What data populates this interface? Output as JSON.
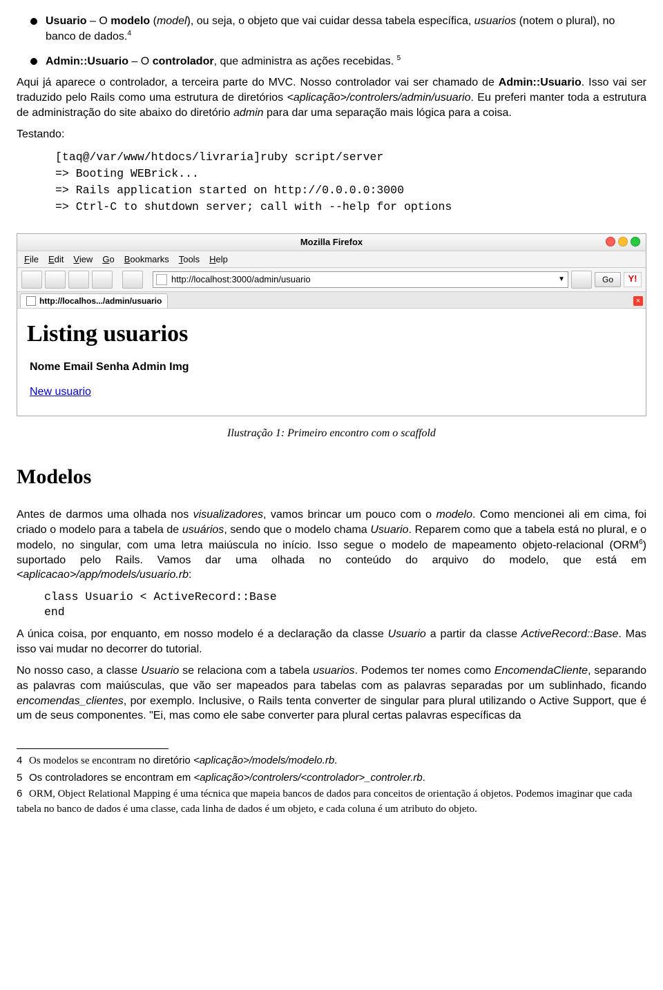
{
  "bullets": {
    "usuario": {
      "label_bold": "Usuario",
      "dash": " – O ",
      "modelo_bold": "modelo",
      "open": " (",
      "model_it": "model",
      "rest1": "), ou seja, o objeto que vai cuidar dessa tabela específica, ",
      "rest2": "usuarios",
      "rest3": " (notem o plural), no banco de dados.",
      "fn": "4"
    },
    "admin": {
      "label_bold": "Admin::Usuario",
      "dash": " – O ",
      "ctrl_bold": "controlador",
      "rest": ", que administra as ações recebidas. ",
      "fn": "5"
    }
  },
  "intro": {
    "l1a": "Aqui já aparece o controlador, a terceira parte do MVC.  Nosso controlador vai ser chamado de ",
    "l1b": "Admin::Usuario",
    "l2a": ".  Isso  vai  ser  traduzido  pelo  Rails  como  uma  estrutura  de  diretórios ",
    "path": "<aplicação>/controlers/admin/usuario",
    "l3": ". Eu preferi manter toda a estrutura de administração do site abaixo do diretório ",
    "admin_it": "admin",
    "l4": " para dar uma separação mais lógica para a coisa."
  },
  "testing_label": "Testando:",
  "terminal": "[taq@/var/www/htdocs/livraria]ruby script/server\n=> Booting WEBrick...\n=> Rails application started on http://0.0.0.0:3000\n=> Ctrl-C to shutdown server; call with --help for options",
  "browser": {
    "title": "Mozilla Firefox",
    "menus": {
      "file": "File",
      "edit": "Edit",
      "view": "View",
      "go": "Go",
      "bookmarks": "Bookmarks",
      "tools": "Tools",
      "help": "Help"
    },
    "url": "http://localhost:3000/admin/usuario",
    "go": "Go",
    "y": "Y!",
    "tab": "http://localhos.../admin/usuario",
    "page_h1": "Listing usuarios",
    "columns": "Nome Email Senha Admin Img",
    "new_link": "New usuario"
  },
  "caption": "Ilustração 1: Primeiro encontro com o scaffold",
  "h2": "Modelos",
  "modelos_para": {
    "a": "Antes de darmos uma olhada nos ",
    "vis_it": "visualizadores",
    "b": ", vamos brincar um pouco com o ",
    "modelo_it": "modelo",
    "c": ". Como mencionei ali em cima, foi criado o modelo para a tabela de ",
    "usu_it": "usuários",
    "d": ", sendo que o modelo chama ",
    "Usu_it": "Usuario",
    "e": ". Reparem como que a tabela está no plural, e o modelo, no singular, com uma letra  maiúscula  no  início.  Isso  segue  o  modelo  de  mapeamento  objeto-relacional  (ORM",
    "fn": "6",
    "f": ") suportado pelo Rails.  Vamos dar uma olhada no conteúdo do arquivo do modelo, que está em ",
    "path_it": "<aplicacao>/app/models/usuario.rb",
    "g": ":"
  },
  "code2": "class Usuario < ActiveRecord::Base\nend",
  "after_code": {
    "a": "A  única  coisa,  por  enquanto,  em  nosso  modelo  é  a  declaração  da  classe  ",
    "u_it": "Usuario",
    "b": "  a  partir  da classe ",
    "ar_it": "ActiveRecord::Base",
    "c": ". Mas isso vai mudar no decorrer do tutorial."
  },
  "last_para": {
    "a": "No nosso caso, a classe ",
    "u_it": "Usuario",
    "b": " se relaciona com a tabela ",
    "tbl_it": "usuarios",
    "c": ". Podemos ter nomes como ",
    "enc_it": "EncomendaCliente",
    "d": ", separando as palavras com maiúsculas, que vão ser mapeados para tabelas com  as  palavras  separadas  por  um  sublinhado,  ficando  ",
    "ec_it": "encomendas_clientes",
    "e": ",  por  exemplo. Inclusive, o Rails tenta converter de singular para plural utilizando o Active Support, que é um de seus componentes. \"Ei, mas como ele sabe converter para plural certas palavras específicas da"
  },
  "footnotes": {
    "f4a": "Os modelos se encontram",
    "f4b": " no diretório ",
    "f4c": "<aplicação>/models/modelo.rb",
    "f4d": ".",
    "f5a": "Os controladores se encontram em ",
    "f5b": "<aplicação>/controlers/<controlador>_controler.rb",
    "f5c": ".",
    "f6a": "ORM, Object Relational Mapping é uma técnica que mapeia bancos de dados para conceitos de orientação á objetos. Podemos imaginar que cada tabela no banco de dados é uma classe, cada linha de dados é um objeto, e cada coluna é um atributo do objeto."
  }
}
